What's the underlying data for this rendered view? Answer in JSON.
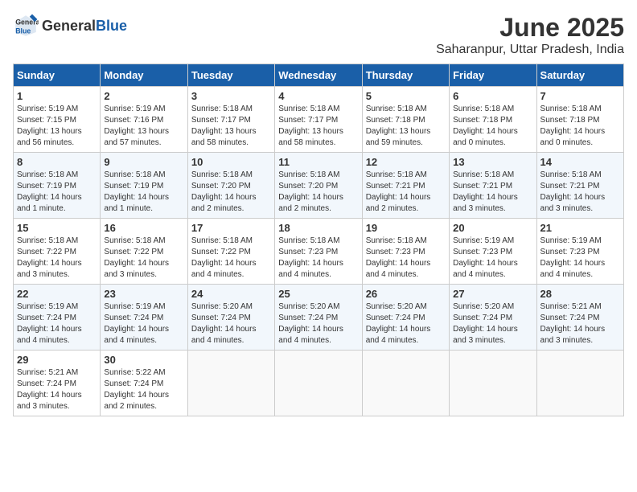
{
  "header": {
    "logo_general": "General",
    "logo_blue": "Blue",
    "title": "June 2025",
    "subtitle": "Saharanpur, Uttar Pradesh, India"
  },
  "days_of_week": [
    "Sunday",
    "Monday",
    "Tuesday",
    "Wednesday",
    "Thursday",
    "Friday",
    "Saturday"
  ],
  "weeks": [
    [
      {
        "day": "1",
        "info": "Sunrise: 5:19 AM\nSunset: 7:15 PM\nDaylight: 13 hours\nand 56 minutes."
      },
      {
        "day": "2",
        "info": "Sunrise: 5:19 AM\nSunset: 7:16 PM\nDaylight: 13 hours\nand 57 minutes."
      },
      {
        "day": "3",
        "info": "Sunrise: 5:18 AM\nSunset: 7:17 PM\nDaylight: 13 hours\nand 58 minutes."
      },
      {
        "day": "4",
        "info": "Sunrise: 5:18 AM\nSunset: 7:17 PM\nDaylight: 13 hours\nand 58 minutes."
      },
      {
        "day": "5",
        "info": "Sunrise: 5:18 AM\nSunset: 7:18 PM\nDaylight: 13 hours\nand 59 minutes."
      },
      {
        "day": "6",
        "info": "Sunrise: 5:18 AM\nSunset: 7:18 PM\nDaylight: 14 hours\nand 0 minutes."
      },
      {
        "day": "7",
        "info": "Sunrise: 5:18 AM\nSunset: 7:18 PM\nDaylight: 14 hours\nand 0 minutes."
      }
    ],
    [
      {
        "day": "8",
        "info": "Sunrise: 5:18 AM\nSunset: 7:19 PM\nDaylight: 14 hours\nand 1 minute."
      },
      {
        "day": "9",
        "info": "Sunrise: 5:18 AM\nSunset: 7:19 PM\nDaylight: 14 hours\nand 1 minute."
      },
      {
        "day": "10",
        "info": "Sunrise: 5:18 AM\nSunset: 7:20 PM\nDaylight: 14 hours\nand 2 minutes."
      },
      {
        "day": "11",
        "info": "Sunrise: 5:18 AM\nSunset: 7:20 PM\nDaylight: 14 hours\nand 2 minutes."
      },
      {
        "day": "12",
        "info": "Sunrise: 5:18 AM\nSunset: 7:21 PM\nDaylight: 14 hours\nand 2 minutes."
      },
      {
        "day": "13",
        "info": "Sunrise: 5:18 AM\nSunset: 7:21 PM\nDaylight: 14 hours\nand 3 minutes."
      },
      {
        "day": "14",
        "info": "Sunrise: 5:18 AM\nSunset: 7:21 PM\nDaylight: 14 hours\nand 3 minutes."
      }
    ],
    [
      {
        "day": "15",
        "info": "Sunrise: 5:18 AM\nSunset: 7:22 PM\nDaylight: 14 hours\nand 3 minutes."
      },
      {
        "day": "16",
        "info": "Sunrise: 5:18 AM\nSunset: 7:22 PM\nDaylight: 14 hours\nand 3 minutes."
      },
      {
        "day": "17",
        "info": "Sunrise: 5:18 AM\nSunset: 7:22 PM\nDaylight: 14 hours\nand 4 minutes."
      },
      {
        "day": "18",
        "info": "Sunrise: 5:18 AM\nSunset: 7:23 PM\nDaylight: 14 hours\nand 4 minutes."
      },
      {
        "day": "19",
        "info": "Sunrise: 5:18 AM\nSunset: 7:23 PM\nDaylight: 14 hours\nand 4 minutes."
      },
      {
        "day": "20",
        "info": "Sunrise: 5:19 AM\nSunset: 7:23 PM\nDaylight: 14 hours\nand 4 minutes."
      },
      {
        "day": "21",
        "info": "Sunrise: 5:19 AM\nSunset: 7:23 PM\nDaylight: 14 hours\nand 4 minutes."
      }
    ],
    [
      {
        "day": "22",
        "info": "Sunrise: 5:19 AM\nSunset: 7:24 PM\nDaylight: 14 hours\nand 4 minutes."
      },
      {
        "day": "23",
        "info": "Sunrise: 5:19 AM\nSunset: 7:24 PM\nDaylight: 14 hours\nand 4 minutes."
      },
      {
        "day": "24",
        "info": "Sunrise: 5:20 AM\nSunset: 7:24 PM\nDaylight: 14 hours\nand 4 minutes."
      },
      {
        "day": "25",
        "info": "Sunrise: 5:20 AM\nSunset: 7:24 PM\nDaylight: 14 hours\nand 4 minutes."
      },
      {
        "day": "26",
        "info": "Sunrise: 5:20 AM\nSunset: 7:24 PM\nDaylight: 14 hours\nand 4 minutes."
      },
      {
        "day": "27",
        "info": "Sunrise: 5:20 AM\nSunset: 7:24 PM\nDaylight: 14 hours\nand 3 minutes."
      },
      {
        "day": "28",
        "info": "Sunrise: 5:21 AM\nSunset: 7:24 PM\nDaylight: 14 hours\nand 3 minutes."
      }
    ],
    [
      {
        "day": "29",
        "info": "Sunrise: 5:21 AM\nSunset: 7:24 PM\nDaylight: 14 hours\nand 3 minutes."
      },
      {
        "day": "30",
        "info": "Sunrise: 5:22 AM\nSunset: 7:24 PM\nDaylight: 14 hours\nand 2 minutes."
      },
      {
        "day": "",
        "info": ""
      },
      {
        "day": "",
        "info": ""
      },
      {
        "day": "",
        "info": ""
      },
      {
        "day": "",
        "info": ""
      },
      {
        "day": "",
        "info": ""
      }
    ]
  ]
}
